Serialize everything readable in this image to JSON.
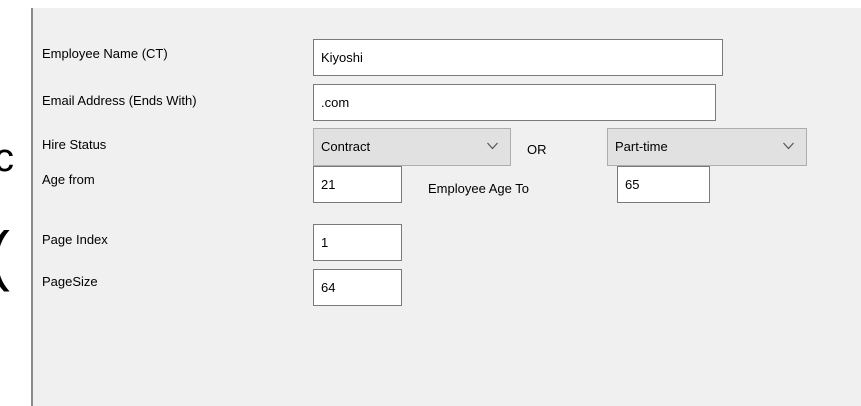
{
  "form": {
    "employee_name": {
      "label": "Employee Name (CT)",
      "value": "Kiyoshi"
    },
    "email": {
      "label": "Email Address (Ends With)",
      "value": ".com"
    },
    "hire_status": {
      "label": "Hire Status",
      "primary_selected": "Contract",
      "connector": "OR",
      "secondary_selected": "Part-time"
    },
    "age_from": {
      "label": "Age from",
      "value": "21"
    },
    "age_to": {
      "label": "Employee Age To",
      "value": "65"
    },
    "page_index": {
      "label": "Page Index",
      "value": "1"
    },
    "page_size": {
      "label": "PageSize",
      "value": "64"
    }
  },
  "background_glyphs": {
    "upper": "c",
    "lower": "("
  },
  "colors": {
    "panel_bg": "#f0f0f0",
    "input_border": "#7a7a7a",
    "select_bg": "#e1e1e1"
  },
  "icons": {
    "dropdown": "chevron-down-icon"
  }
}
